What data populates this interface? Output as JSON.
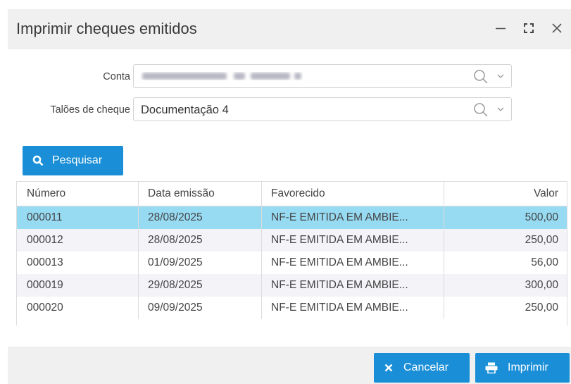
{
  "dialog": {
    "title": "Imprimir cheques emitidos",
    "controls": {
      "minimize": "minimize-icon",
      "maximize": "maximize-icon",
      "close": "close-icon"
    }
  },
  "form": {
    "conta_label": "Conta",
    "conta_value_hidden": true,
    "taloes_label": "Talões de cheque",
    "taloes_value": "Documentação 4"
  },
  "search": {
    "label": "Pesquisar",
    "icon": "search-icon"
  },
  "grid": {
    "columns": [
      "Número",
      "Data emissão",
      "Favorecido",
      "Valor"
    ],
    "rows": [
      {
        "numero": "000011",
        "data": "28/08/2025",
        "favorecido": "NF-E EMITIDA EM AMBIE...",
        "valor": "500,00",
        "selected": true
      },
      {
        "numero": "000012",
        "data": "28/08/2025",
        "favorecido": "NF-E EMITIDA EM AMBIE...",
        "valor": "250,00"
      },
      {
        "numero": "000013",
        "data": "01/09/2025",
        "favorecido": "NF-E EMITIDA EM AMBIE...",
        "valor": "56,00"
      },
      {
        "numero": "000019",
        "data": "29/08/2025",
        "favorecido": "NF-E EMITIDA EM AMBIE...",
        "valor": "300,00"
      },
      {
        "numero": "000020",
        "data": "09/09/2025",
        "favorecido": "NF-E EMITIDA EM AMBIE...",
        "valor": "250,00"
      }
    ]
  },
  "footer": {
    "cancel_label": "Cancelar",
    "print_label": "Imprimir"
  },
  "colors": {
    "accent": "#1a8fd8",
    "selected_row": "#97dbf3",
    "alt_row": "#f3f3f8",
    "titlebar": "#f0f0f0"
  }
}
